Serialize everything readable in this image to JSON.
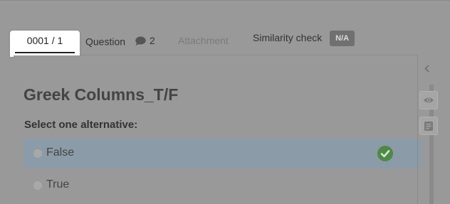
{
  "tabs": {
    "id_label": "0001 / 1",
    "question_label": "Question",
    "comment_count": "2",
    "attachment_label": "Attachment",
    "similarity_label": "Similarity check",
    "similarity_badge": "N/A"
  },
  "question": {
    "title": "Greek Columns_T/F",
    "prompt": "Select one alternative:",
    "alternatives": [
      {
        "label": "False",
        "selected": true,
        "correct": true
      },
      {
        "label": "True",
        "selected": false,
        "correct": false
      }
    ]
  },
  "icons": {
    "comment": "speech-bubble-icon",
    "check": "check-circle-icon",
    "collapse": "chevron-left-icon",
    "preview": "eye-icon",
    "notes": "note-icon"
  },
  "colors": {
    "overlay_gray": "#999999",
    "selected_row": "#8b9ba8",
    "correct_green": "#4e8a45"
  }
}
